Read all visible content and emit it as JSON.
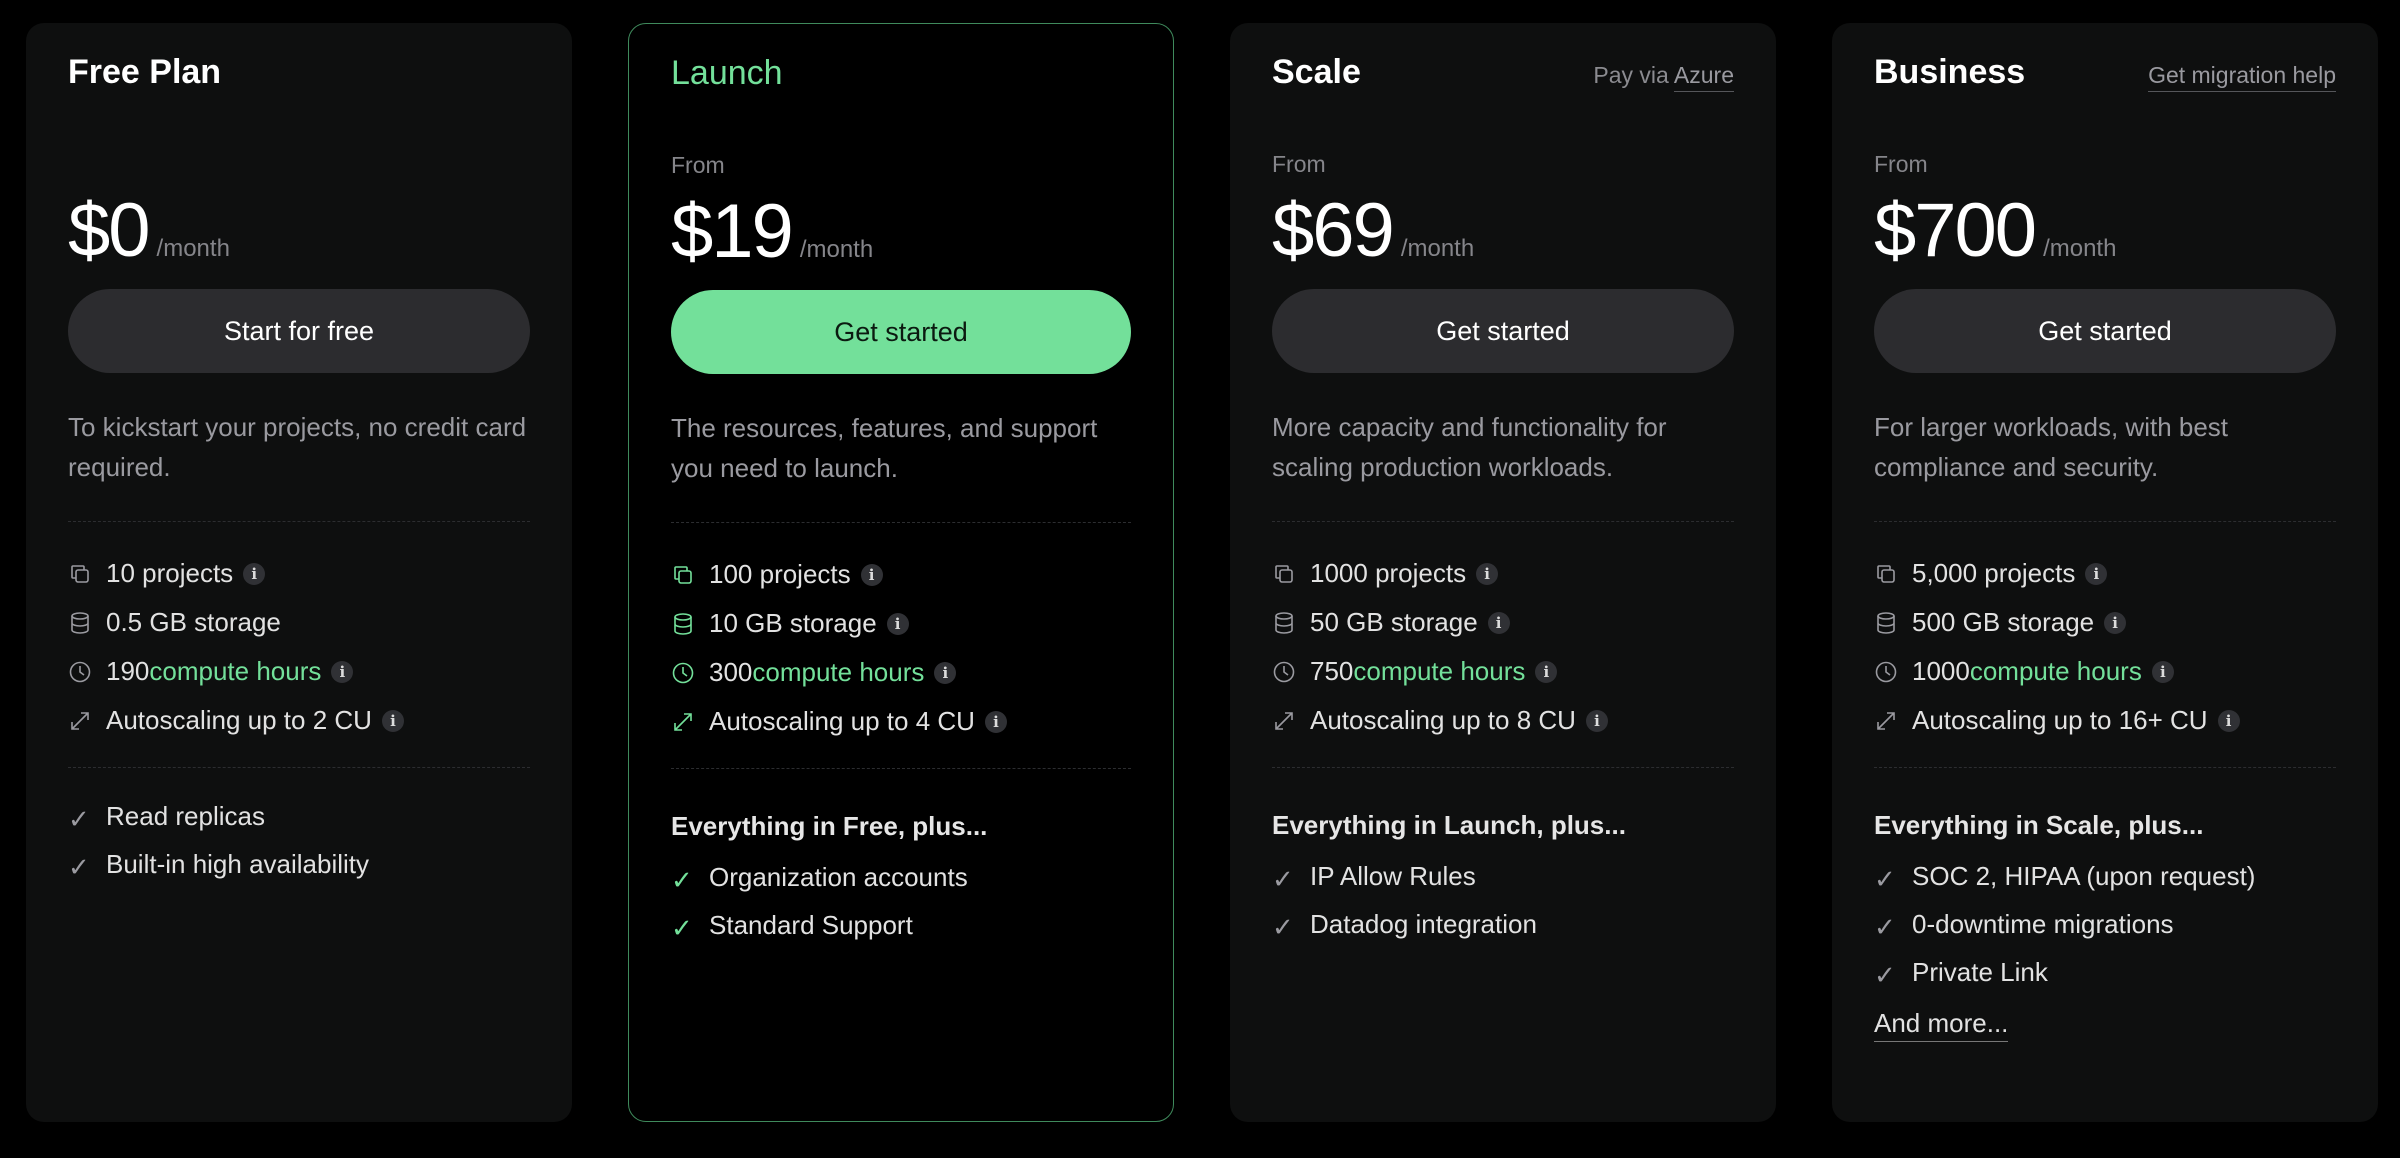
{
  "plans": [
    {
      "title": "Free Plan",
      "side_prefix": "",
      "side_link": "",
      "from": "",
      "price": "$0",
      "per": "/month",
      "button": "Start for free",
      "desc": "To kickstart your projects, no credit card required.",
      "features": [
        {
          "pre": "10 projects",
          "hl": "",
          "info": true
        },
        {
          "pre": "0.5 GB storage",
          "hl": "",
          "info": false
        },
        {
          "pre": "190 ",
          "hl": "compute hours",
          "info": true
        },
        {
          "pre": "Autoscaling up to 2 CU",
          "hl": "",
          "info": true
        }
      ],
      "plus": "",
      "checks": [
        "Read replicas",
        "Built-in high availability"
      ],
      "more": ""
    },
    {
      "title": "Launch",
      "side_prefix": "",
      "side_link": "",
      "from": "From",
      "price": "$19",
      "per": "/month",
      "button": "Get started",
      "desc": "The resources, features, and support you need to launch.",
      "features": [
        {
          "pre": "100 projects",
          "hl": "",
          "info": true
        },
        {
          "pre": "10 GB storage",
          "hl": "",
          "info": true
        },
        {
          "pre": "300 ",
          "hl": "compute hours",
          "info": true
        },
        {
          "pre": "Autoscaling up to 4 CU",
          "hl": "",
          "info": true
        }
      ],
      "plus": "Everything in Free, plus...",
      "checks": [
        "Organization accounts",
        "Standard Support"
      ],
      "more": ""
    },
    {
      "title": "Scale",
      "side_prefix": "Pay via ",
      "side_link": "Azure",
      "from": "From",
      "price": "$69",
      "per": "/month",
      "button": "Get started",
      "desc": "More capacity and functionality for scaling production workloads.",
      "features": [
        {
          "pre": "1000 projects",
          "hl": "",
          "info": true
        },
        {
          "pre": "50 GB storage",
          "hl": "",
          "info": true
        },
        {
          "pre": "750 ",
          "hl": "compute hours",
          "info": true
        },
        {
          "pre": "Autoscaling up to 8 CU",
          "hl": "",
          "info": true
        }
      ],
      "plus": "Everything in Launch, plus...",
      "checks": [
        "IP Allow Rules",
        "Datadog integration"
      ],
      "more": ""
    },
    {
      "title": "Business",
      "side_prefix": "",
      "side_link": "Get migration help",
      "from": "From",
      "price": "$700",
      "per": "/month",
      "button": "Get started",
      "desc": "For larger workloads, with best compliance and security.",
      "features": [
        {
          "pre": "5,000 projects",
          "hl": "",
          "info": true
        },
        {
          "pre": "500 GB storage",
          "hl": "",
          "info": true
        },
        {
          "pre": "1000 ",
          "hl": "compute hours",
          "info": true
        },
        {
          "pre": "Autoscaling up to 16+ CU",
          "hl": "",
          "info": true
        }
      ],
      "plus": "Everything in Scale, plus...",
      "checks": [
        "SOC 2, HIPAA (upon request)",
        "0-downtime migrations",
        "Private Link"
      ],
      "more": "And more..."
    }
  ],
  "info_glyph": "i",
  "check_glyph": "✓",
  "colors": {
    "accent": "#73e09a",
    "card": "#0e0f0f",
    "button": "#2c2c2f"
  }
}
